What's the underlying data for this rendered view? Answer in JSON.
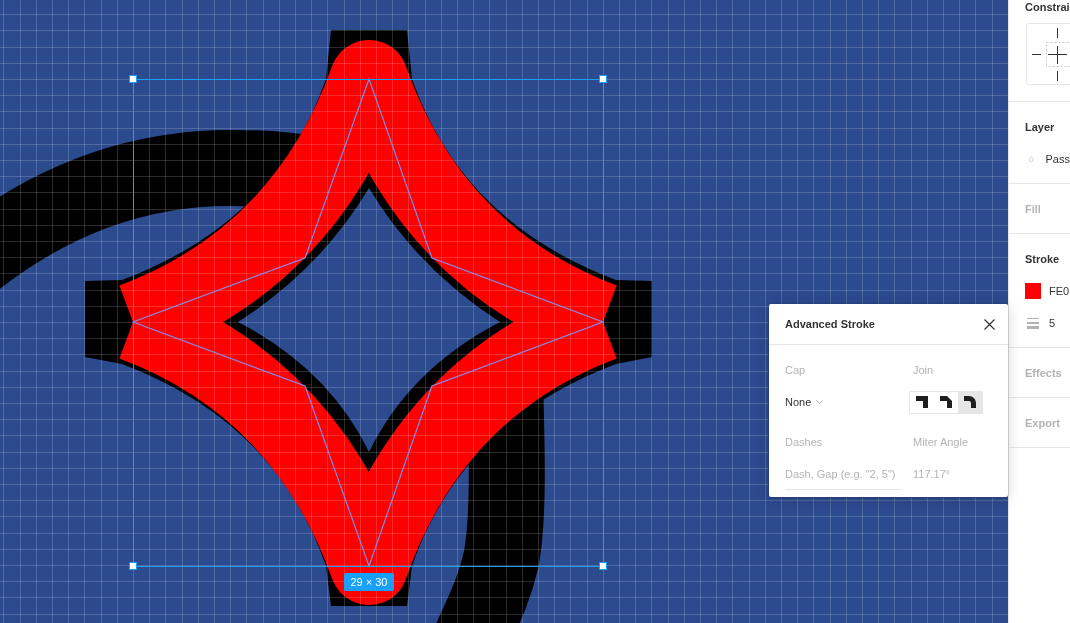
{
  "canvas": {
    "selection": {
      "size_label": "29 × 30"
    }
  },
  "properties_panel": {
    "sections": [
      {
        "kind": "constraints",
        "title": "Constrai",
        "empty": false
      },
      {
        "kind": "layer",
        "title": "Layer",
        "empty": false,
        "blend_mode": "Pass"
      },
      {
        "kind": "fill",
        "title": "Fill",
        "empty": true
      },
      {
        "kind": "stroke",
        "title": "Stroke",
        "empty": false,
        "color": "#fe0000",
        "hex": "FE0",
        "weight": "5"
      },
      {
        "kind": "effects",
        "title": "Effects",
        "empty": true
      },
      {
        "kind": "export",
        "title": "Export",
        "empty": true
      }
    ]
  },
  "advanced_stroke": {
    "title": "Advanced Stroke",
    "cap": {
      "label": "Cap",
      "value": "None"
    },
    "join": {
      "label": "Join",
      "options": [
        {
          "kind": "miter",
          "selected": false
        },
        {
          "kind": "bevel",
          "selected": false
        },
        {
          "kind": "round",
          "selected": true
        }
      ]
    },
    "dashes": {
      "label": "Dashes",
      "placeholder": "Dash, Gap (e.g. \"2, 5\")"
    },
    "miter_angle": {
      "label": "Miter Angle",
      "value": "117.17°",
      "disabled": true
    }
  }
}
